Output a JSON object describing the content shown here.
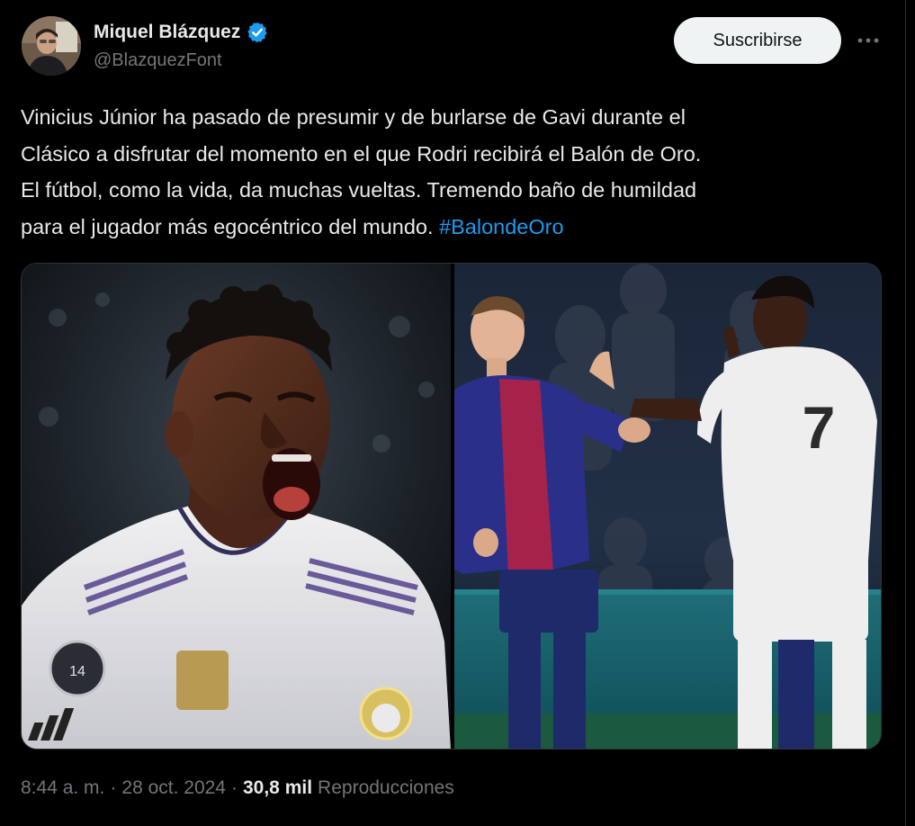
{
  "author": {
    "name": "Miquel Blázquez",
    "handle": "@BlazquezFont",
    "verified": true,
    "verified_color": "#1d9bf0"
  },
  "actions": {
    "subscribe_label": "Suscribirse",
    "more_icon": "more-horizontal-icon"
  },
  "tweet": {
    "text_lines": [
      "Vinicius Júnior ha pasado de presumir y de burlarse de Gavi durante el",
      "Clásico a disfrutar del momento en el que Rodri recibirá el Balón de Oro.",
      "El fútbol, como la vida, da muchas vueltas. Tremendo baño de humildad",
      "para el jugador más egocéntrico del mundo."
    ],
    "hashtag": "#BalondeOro",
    "hashtag_color": "#1d9bf0"
  },
  "media": {
    "count": 2
  },
  "footer": {
    "time": "8:44 a. m.",
    "separator": "·",
    "date": "28 oct. 2024",
    "views_count": "30,8 mil",
    "views_label": "Reproducciones"
  },
  "colors": {
    "background": "#000000",
    "text_primary": "#e7e9ea",
    "text_secondary": "#71767b",
    "button_bg": "#eff3f4",
    "button_text": "#0f1419"
  }
}
